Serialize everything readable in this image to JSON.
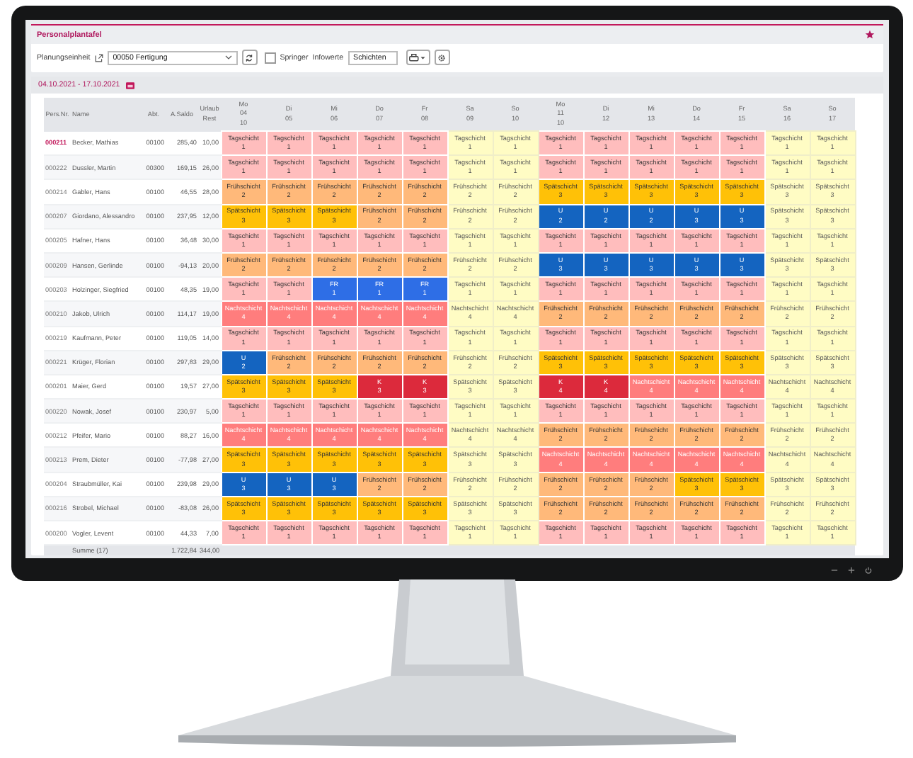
{
  "app": {
    "title": "Personalplantafel"
  },
  "toolbar": {
    "unit_label": "Planungseinheit",
    "unit_value": "00050 Fertigung",
    "springer": {
      "label": "Springer",
      "checked": false
    },
    "info_label": "Infowerte",
    "info_value": "Schichten"
  },
  "period": {
    "label": "04.10.2021 - 17.10.2021"
  },
  "table": {
    "columns": [
      "Pers.Nr.",
      "Name",
      "Abt.",
      "A.Saldo",
      "Urlaub Rest"
    ],
    "days": [
      {
        "weekday": "Mo",
        "date": "04",
        "week": "10",
        "weekend": false
      },
      {
        "weekday": "Di",
        "date": "05",
        "weekend": false
      },
      {
        "weekday": "Mi",
        "date": "06",
        "weekend": false
      },
      {
        "weekday": "Do",
        "date": "07",
        "weekend": false
      },
      {
        "weekday": "Fr",
        "date": "08",
        "weekend": false
      },
      {
        "weekday": "Sa",
        "date": "09",
        "weekend": true
      },
      {
        "weekday": "So",
        "date": "10",
        "weekend": true
      },
      {
        "weekday": "Mo",
        "date": "11",
        "week": "10",
        "weekend": false
      },
      {
        "weekday": "Di",
        "date": "12",
        "weekend": false
      },
      {
        "weekday": "Mi",
        "date": "13",
        "weekend": false
      },
      {
        "weekday": "Do",
        "date": "14",
        "weekend": false
      },
      {
        "weekday": "Fr",
        "date": "15",
        "weekend": false
      },
      {
        "weekday": "Sa",
        "date": "16",
        "weekend": true
      },
      {
        "weekday": "So",
        "date": "17",
        "weekend": true
      }
    ],
    "rows": [
      {
        "id": "000211",
        "selected": true,
        "name": "Becker, Mathias",
        "dept": "00100",
        "saldo": "285,40",
        "vacation": "10,00",
        "cells": [
          {
            "kind": "tag",
            "label": "Tagschicht",
            "code": "1"
          },
          {
            "kind": "tag",
            "label": "Tagschicht",
            "code": "1"
          },
          {
            "kind": "tag",
            "label": "Tagschicht",
            "code": "1"
          },
          {
            "kind": "tag",
            "label": "Tagschicht",
            "code": "1"
          },
          {
            "kind": "tag",
            "label": "Tagschicht",
            "code": "1"
          },
          {
            "kind": "tag",
            "label": "Tagschicht",
            "code": "1"
          },
          {
            "kind": "tag",
            "label": "Tagschicht",
            "code": "1"
          },
          {
            "kind": "tag",
            "label": "Tagschicht",
            "code": "1"
          },
          {
            "kind": "tag",
            "label": "Tagschicht",
            "code": "1"
          },
          {
            "kind": "tag",
            "label": "Tagschicht",
            "code": "1"
          },
          {
            "kind": "tag",
            "label": "Tagschicht",
            "code": "1"
          },
          {
            "kind": "tag",
            "label": "Tagschicht",
            "code": "1"
          },
          {
            "kind": "tag",
            "label": "Tagschicht",
            "code": "1"
          },
          {
            "kind": "tag",
            "label": "Tagschicht",
            "code": "1"
          }
        ]
      },
      {
        "id": "000222",
        "selected": false,
        "name": "Dussler, Martin",
        "dept": "00300",
        "saldo": "169,15",
        "vacation": "26,00",
        "cells": [
          {
            "kind": "tag",
            "label": "Tagschicht",
            "code": "1"
          },
          {
            "kind": "tag",
            "label": "Tagschicht",
            "code": "1"
          },
          {
            "kind": "tag",
            "label": "Tagschicht",
            "code": "1"
          },
          {
            "kind": "tag",
            "label": "Tagschicht",
            "code": "1"
          },
          {
            "kind": "tag",
            "label": "Tagschicht",
            "code": "1"
          },
          {
            "kind": "tag",
            "label": "Tagschicht",
            "code": "1"
          },
          {
            "kind": "tag",
            "label": "Tagschicht",
            "code": "1"
          },
          {
            "kind": "tag",
            "label": "Tagschicht",
            "code": "1"
          },
          {
            "kind": "tag",
            "label": "Tagschicht",
            "code": "1"
          },
          {
            "kind": "tag",
            "label": "Tagschicht",
            "code": "1"
          },
          {
            "kind": "tag",
            "label": "Tagschicht",
            "code": "1"
          },
          {
            "kind": "tag",
            "label": "Tagschicht",
            "code": "1"
          },
          {
            "kind": "tag",
            "label": "Tagschicht",
            "code": "1"
          },
          {
            "kind": "tag",
            "label": "Tagschicht",
            "code": "1"
          }
        ]
      },
      {
        "id": "000214",
        "selected": false,
        "name": "Gabler, Hans",
        "dept": "00100",
        "saldo": "46,55",
        "vacation": "28,00",
        "cells": [
          {
            "kind": "frueh",
            "label": "Frühschicht",
            "code": "2"
          },
          {
            "kind": "frueh",
            "label": "Frühschicht",
            "code": "2"
          },
          {
            "kind": "frueh",
            "label": "Frühschicht",
            "code": "2"
          },
          {
            "kind": "frueh",
            "label": "Frühschicht",
            "code": "2"
          },
          {
            "kind": "frueh",
            "label": "Frühschicht",
            "code": "2"
          },
          {
            "kind": "frueh",
            "label": "Frühschicht",
            "code": "2"
          },
          {
            "kind": "frueh",
            "label": "Frühschicht",
            "code": "2"
          },
          {
            "kind": "spaet",
            "label": "Spätschicht",
            "code": "3"
          },
          {
            "kind": "spaet",
            "label": "Spätschicht",
            "code": "3"
          },
          {
            "kind": "spaet",
            "label": "Spätschicht",
            "code": "3"
          },
          {
            "kind": "spaet",
            "label": "Spätschicht",
            "code": "3"
          },
          {
            "kind": "spaet",
            "label": "Spätschicht",
            "code": "3"
          },
          {
            "kind": "spaet",
            "label": "Spätschicht",
            "code": "3"
          },
          {
            "kind": "spaet",
            "label": "Spätschicht",
            "code": "3"
          }
        ]
      },
      {
        "id": "000207",
        "selected": false,
        "name": "Giordano, Alessandro",
        "dept": "00100",
        "saldo": "237,95",
        "vacation": "12,00",
        "cells": [
          {
            "kind": "spaet",
            "label": "Spätschicht",
            "code": "3"
          },
          {
            "kind": "spaet",
            "label": "Spätschicht",
            "code": "3"
          },
          {
            "kind": "spaet",
            "label": "Spätschicht",
            "code": "3"
          },
          {
            "kind": "frueh",
            "label": "Frühschicht",
            "code": "2"
          },
          {
            "kind": "frueh",
            "label": "Frühschicht",
            "code": "2"
          },
          {
            "kind": "frueh",
            "label": "Frühschicht",
            "code": "2"
          },
          {
            "kind": "frueh",
            "label": "Frühschicht",
            "code": "2"
          },
          {
            "kind": "urlaub",
            "label": "U",
            "code": "2"
          },
          {
            "kind": "urlaub",
            "label": "U",
            "code": "2"
          },
          {
            "kind": "urlaub",
            "label": "U",
            "code": "2"
          },
          {
            "kind": "urlaub",
            "label": "U",
            "code": "3"
          },
          {
            "kind": "urlaub",
            "label": "U",
            "code": "3"
          },
          {
            "kind": "spaet",
            "label": "Spätschicht",
            "code": "3"
          },
          {
            "kind": "spaet",
            "label": "Spätschicht",
            "code": "3"
          }
        ]
      },
      {
        "id": "000205",
        "selected": false,
        "name": "Hafner, Hans",
        "dept": "00100",
        "saldo": "36,48",
        "vacation": "30,00",
        "cells": [
          {
            "kind": "tag",
            "label": "Tagschicht",
            "code": "1"
          },
          {
            "kind": "tag",
            "label": "Tagschicht",
            "code": "1"
          },
          {
            "kind": "tag",
            "label": "Tagschicht",
            "code": "1"
          },
          {
            "kind": "tag",
            "label": "Tagschicht",
            "code": "1"
          },
          {
            "kind": "tag",
            "label": "Tagschicht",
            "code": "1"
          },
          {
            "kind": "tag",
            "label": "Tagschicht",
            "code": "1"
          },
          {
            "kind": "tag",
            "label": "Tagschicht",
            "code": "1"
          },
          {
            "kind": "tag",
            "label": "Tagschicht",
            "code": "1"
          },
          {
            "kind": "tag",
            "label": "Tagschicht",
            "code": "1"
          },
          {
            "kind": "tag",
            "label": "Tagschicht",
            "code": "1"
          },
          {
            "kind": "tag",
            "label": "Tagschicht",
            "code": "1"
          },
          {
            "kind": "tag",
            "label": "Tagschicht",
            "code": "1"
          },
          {
            "kind": "tag",
            "label": "Tagschicht",
            "code": "1"
          },
          {
            "kind": "tag",
            "label": "Tagschicht",
            "code": "1"
          }
        ]
      },
      {
        "id": "000209",
        "selected": false,
        "name": "Hansen, Gerlinde",
        "dept": "00100",
        "saldo": "-94,13",
        "vacation": "20,00",
        "cells": [
          {
            "kind": "frueh",
            "label": "Frühschicht",
            "code": "2"
          },
          {
            "kind": "frueh",
            "label": "Frühschicht",
            "code": "2"
          },
          {
            "kind": "frueh",
            "label": "Frühschicht",
            "code": "2"
          },
          {
            "kind": "frueh",
            "label": "Frühschicht",
            "code": "2"
          },
          {
            "kind": "frueh",
            "label": "Frühschicht",
            "code": "2"
          },
          {
            "kind": "frueh",
            "label": "Frühschicht",
            "code": "2"
          },
          {
            "kind": "frueh",
            "label": "Frühschicht",
            "code": "2"
          },
          {
            "kind": "urlaub",
            "label": "U",
            "code": "3"
          },
          {
            "kind": "urlaub",
            "label": "U",
            "code": "3"
          },
          {
            "kind": "urlaub",
            "label": "U",
            "code": "3"
          },
          {
            "kind": "urlaub",
            "label": "U",
            "code": "3"
          },
          {
            "kind": "urlaub",
            "label": "U",
            "code": "3"
          },
          {
            "kind": "spaet",
            "label": "Spätschicht",
            "code": "3"
          },
          {
            "kind": "spaet",
            "label": "Spätschicht",
            "code": "3"
          }
        ]
      },
      {
        "id": "000203",
        "selected": false,
        "name": "Holzinger, Siegfried",
        "dept": "00100",
        "saldo": "48,35",
        "vacation": "19,00",
        "cells": [
          {
            "kind": "tag",
            "label": "Tagschicht",
            "code": "1"
          },
          {
            "kind": "tag",
            "label": "Tagschicht",
            "code": "1"
          },
          {
            "kind": "frei",
            "label": "FR",
            "code": "1"
          },
          {
            "kind": "frei",
            "label": "FR",
            "code": "1"
          },
          {
            "kind": "frei",
            "label": "FR",
            "code": "1"
          },
          {
            "kind": "tag",
            "label": "Tagschicht",
            "code": "1"
          },
          {
            "kind": "tag",
            "label": "Tagschicht",
            "code": "1"
          },
          {
            "kind": "tag",
            "label": "Tagschicht",
            "code": "1"
          },
          {
            "kind": "tag",
            "label": "Tagschicht",
            "code": "1"
          },
          {
            "kind": "tag",
            "label": "Tagschicht",
            "code": "1"
          },
          {
            "kind": "tag",
            "label": "Tagschicht",
            "code": "1"
          },
          {
            "kind": "tag",
            "label": "Tagschicht",
            "code": "1"
          },
          {
            "kind": "tag",
            "label": "Tagschicht",
            "code": "1"
          },
          {
            "kind": "tag",
            "label": "Tagschicht",
            "code": "1"
          }
        ]
      },
      {
        "id": "000210",
        "selected": false,
        "name": "Jakob, Ulrich",
        "dept": "00100",
        "saldo": "114,17",
        "vacation": "19,00",
        "cells": [
          {
            "kind": "nacht",
            "label": "Nachtschicht",
            "code": "4"
          },
          {
            "kind": "nacht",
            "label": "Nachtschicht",
            "code": "4"
          },
          {
            "kind": "nacht",
            "label": "Nachtschicht",
            "code": "4"
          },
          {
            "kind": "nacht",
            "label": "Nachtschicht",
            "code": "4"
          },
          {
            "kind": "nacht",
            "label": "Nachtschicht",
            "code": "4"
          },
          {
            "kind": "nacht",
            "label": "Nachtschicht",
            "code": "4"
          },
          {
            "kind": "nacht",
            "label": "Nachtschicht",
            "code": "4"
          },
          {
            "kind": "frueh",
            "label": "Frühschicht",
            "code": "2"
          },
          {
            "kind": "frueh",
            "label": "Frühschicht",
            "code": "2"
          },
          {
            "kind": "frueh",
            "label": "Frühschicht",
            "code": "2"
          },
          {
            "kind": "frueh",
            "label": "Frühschicht",
            "code": "2"
          },
          {
            "kind": "frueh",
            "label": "Frühschicht",
            "code": "2"
          },
          {
            "kind": "frueh",
            "label": "Frühschicht",
            "code": "2"
          },
          {
            "kind": "frueh",
            "label": "Frühschicht",
            "code": "2"
          }
        ]
      },
      {
        "id": "000219",
        "selected": false,
        "name": "Kaufmann, Peter",
        "dept": "00100",
        "saldo": "119,05",
        "vacation": "14,00",
        "cells": [
          {
            "kind": "tag",
            "label": "Tagschicht",
            "code": "1"
          },
          {
            "kind": "tag",
            "label": "Tagschicht",
            "code": "1"
          },
          {
            "kind": "tag",
            "label": "Tagschicht",
            "code": "1"
          },
          {
            "kind": "tag",
            "label": "Tagschicht",
            "code": "1"
          },
          {
            "kind": "tag",
            "label": "Tagschicht",
            "code": "1"
          },
          {
            "kind": "tag",
            "label": "Tagschicht",
            "code": "1"
          },
          {
            "kind": "tag",
            "label": "Tagschicht",
            "code": "1"
          },
          {
            "kind": "tag",
            "label": "Tagschicht",
            "code": "1"
          },
          {
            "kind": "tag",
            "label": "Tagschicht",
            "code": "1"
          },
          {
            "kind": "tag",
            "label": "Tagschicht",
            "code": "1"
          },
          {
            "kind": "tag",
            "label": "Tagschicht",
            "code": "1"
          },
          {
            "kind": "tag",
            "label": "Tagschicht",
            "code": "1"
          },
          {
            "kind": "tag",
            "label": "Tagschicht",
            "code": "1"
          },
          {
            "kind": "tag",
            "label": "Tagschicht",
            "code": "1"
          }
        ]
      },
      {
        "id": "000221",
        "selected": false,
        "name": "Krüger, Florian",
        "dept": "00100",
        "saldo": "297,83",
        "vacation": "29,00",
        "cells": [
          {
            "kind": "urlaub",
            "label": "U",
            "code": "2"
          },
          {
            "kind": "frueh",
            "label": "Frühschicht",
            "code": "2"
          },
          {
            "kind": "frueh",
            "label": "Frühschicht",
            "code": "2"
          },
          {
            "kind": "frueh",
            "label": "Frühschicht",
            "code": "2"
          },
          {
            "kind": "frueh",
            "label": "Frühschicht",
            "code": "2"
          },
          {
            "kind": "frueh",
            "label": "Frühschicht",
            "code": "2"
          },
          {
            "kind": "frueh",
            "label": "Frühschicht",
            "code": "2"
          },
          {
            "kind": "spaet",
            "label": "Spätschicht",
            "code": "3"
          },
          {
            "kind": "spaet",
            "label": "Spätschicht",
            "code": "3"
          },
          {
            "kind": "spaet",
            "label": "Spätschicht",
            "code": "3"
          },
          {
            "kind": "spaet",
            "label": "Spätschicht",
            "code": "3"
          },
          {
            "kind": "spaet",
            "label": "Spätschicht",
            "code": "3"
          },
          {
            "kind": "spaet",
            "label": "Spätschicht",
            "code": "3"
          },
          {
            "kind": "spaet",
            "label": "Spätschicht",
            "code": "3"
          }
        ]
      },
      {
        "id": "000201",
        "selected": false,
        "name": "Maier, Gerd",
        "dept": "00100",
        "saldo": "19,57",
        "vacation": "27,00",
        "cells": [
          {
            "kind": "spaet",
            "label": "Spätschicht",
            "code": "3"
          },
          {
            "kind": "spaet",
            "label": "Spätschicht",
            "code": "3"
          },
          {
            "kind": "spaet",
            "label": "Spätschicht",
            "code": "3"
          },
          {
            "kind": "krank",
            "label": "K",
            "code": "3"
          },
          {
            "kind": "krank",
            "label": "K",
            "code": "3"
          },
          {
            "kind": "spaet",
            "label": "Spätschicht",
            "code": "3"
          },
          {
            "kind": "spaet",
            "label": "Spätschicht",
            "code": "3"
          },
          {
            "kind": "krank",
            "label": "K",
            "code": "4"
          },
          {
            "kind": "krank",
            "label": "K",
            "code": "4"
          },
          {
            "kind": "nacht",
            "label": "Nachtschicht",
            "code": "4"
          },
          {
            "kind": "nacht",
            "label": "Nachtschicht",
            "code": "4"
          },
          {
            "kind": "nacht",
            "label": "Nachtschicht",
            "code": "4"
          },
          {
            "kind": "nacht",
            "label": "Nachtschicht",
            "code": "4"
          },
          {
            "kind": "nacht",
            "label": "Nachtschicht",
            "code": "4"
          }
        ]
      },
      {
        "id": "000220",
        "selected": false,
        "name": "Nowak, Josef",
        "dept": "00100",
        "saldo": "230,97",
        "vacation": "5,00",
        "cells": [
          {
            "kind": "tag",
            "label": "Tagschicht",
            "code": "1"
          },
          {
            "kind": "tag",
            "label": "Tagschicht",
            "code": "1"
          },
          {
            "kind": "tag",
            "label": "Tagschicht",
            "code": "1"
          },
          {
            "kind": "tag",
            "label": "Tagschicht",
            "code": "1"
          },
          {
            "kind": "tag",
            "label": "Tagschicht",
            "code": "1"
          },
          {
            "kind": "tag",
            "label": "Tagschicht",
            "code": "1"
          },
          {
            "kind": "tag",
            "label": "Tagschicht",
            "code": "1"
          },
          {
            "kind": "tag",
            "label": "Tagschicht",
            "code": "1"
          },
          {
            "kind": "tag",
            "label": "Tagschicht",
            "code": "1"
          },
          {
            "kind": "tag",
            "label": "Tagschicht",
            "code": "1"
          },
          {
            "kind": "tag",
            "label": "Tagschicht",
            "code": "1"
          },
          {
            "kind": "tag",
            "label": "Tagschicht",
            "code": "1"
          },
          {
            "kind": "tag",
            "label": "Tagschicht",
            "code": "1"
          },
          {
            "kind": "tag",
            "label": "Tagschicht",
            "code": "1"
          }
        ]
      },
      {
        "id": "000212",
        "selected": false,
        "name": "Pfeifer, Mario",
        "dept": "00100",
        "saldo": "88,27",
        "vacation": "16,00",
        "cells": [
          {
            "kind": "nacht",
            "label": "Nachtschicht",
            "code": "4"
          },
          {
            "kind": "nacht",
            "label": "Nachtschicht",
            "code": "4"
          },
          {
            "kind": "nacht",
            "label": "Nachtschicht",
            "code": "4"
          },
          {
            "kind": "nacht",
            "label": "Nachtschicht",
            "code": "4"
          },
          {
            "kind": "nacht",
            "label": "Nachtschicht",
            "code": "4"
          },
          {
            "kind": "nacht",
            "label": "Nachtschicht",
            "code": "4"
          },
          {
            "kind": "nacht",
            "label": "Nachtschicht",
            "code": "4"
          },
          {
            "kind": "frueh",
            "label": "Frühschicht",
            "code": "2"
          },
          {
            "kind": "frueh",
            "label": "Frühschicht",
            "code": "2"
          },
          {
            "kind": "frueh",
            "label": "Frühschicht",
            "code": "2"
          },
          {
            "kind": "frueh",
            "label": "Frühschicht",
            "code": "2"
          },
          {
            "kind": "frueh",
            "label": "Frühschicht",
            "code": "2"
          },
          {
            "kind": "frueh",
            "label": "Frühschicht",
            "code": "2"
          },
          {
            "kind": "frueh",
            "label": "Frühschicht",
            "code": "2"
          }
        ]
      },
      {
        "id": "000213",
        "selected": false,
        "name": "Prem, Dieter",
        "dept": "00100",
        "saldo": "-77,98",
        "vacation": "27,00",
        "cells": [
          {
            "kind": "spaet",
            "label": "Spätschicht",
            "code": "3"
          },
          {
            "kind": "spaet",
            "label": "Spätschicht",
            "code": "3"
          },
          {
            "kind": "spaet",
            "label": "Spätschicht",
            "code": "3"
          },
          {
            "kind": "spaet",
            "label": "Spätschicht",
            "code": "3"
          },
          {
            "kind": "spaet",
            "label": "Spätschicht",
            "code": "3"
          },
          {
            "kind": "spaet",
            "label": "Spätschicht",
            "code": "3"
          },
          {
            "kind": "spaet",
            "label": "Spätschicht",
            "code": "3"
          },
          {
            "kind": "nacht",
            "label": "Nachtschicht",
            "code": "4"
          },
          {
            "kind": "nacht",
            "label": "Nachtschicht",
            "code": "4"
          },
          {
            "kind": "nacht",
            "label": "Nachtschicht",
            "code": "4"
          },
          {
            "kind": "nacht",
            "label": "Nachtschicht",
            "code": "4"
          },
          {
            "kind": "nacht",
            "label": "Nachtschicht",
            "code": "4"
          },
          {
            "kind": "nacht",
            "label": "Nachtschicht",
            "code": "4"
          },
          {
            "kind": "nacht",
            "label": "Nachtschicht",
            "code": "4"
          }
        ]
      },
      {
        "id": "000204",
        "selected": false,
        "name": "Straubmüller, Kai",
        "dept": "00100",
        "saldo": "239,98",
        "vacation": "29,00",
        "cells": [
          {
            "kind": "urlaub",
            "label": "U",
            "code": "3"
          },
          {
            "kind": "urlaub",
            "label": "U",
            "code": "3"
          },
          {
            "kind": "urlaub",
            "label": "U",
            "code": "3"
          },
          {
            "kind": "frueh",
            "label": "Frühschicht",
            "code": "2"
          },
          {
            "kind": "frueh",
            "label": "Frühschicht",
            "code": "2"
          },
          {
            "kind": "frueh",
            "label": "Frühschicht",
            "code": "2"
          },
          {
            "kind": "frueh",
            "label": "Frühschicht",
            "code": "2"
          },
          {
            "kind": "frueh",
            "label": "Frühschicht",
            "code": "2"
          },
          {
            "kind": "frueh",
            "label": "Frühschicht",
            "code": "2"
          },
          {
            "kind": "frueh",
            "label": "Frühschicht",
            "code": "2"
          },
          {
            "kind": "spaet",
            "label": "Spätschicht",
            "code": "3"
          },
          {
            "kind": "spaet",
            "label": "Spätschicht",
            "code": "3"
          },
          {
            "kind": "spaet",
            "label": "Spätschicht",
            "code": "3"
          },
          {
            "kind": "spaet",
            "label": "Spätschicht",
            "code": "3"
          }
        ]
      },
      {
        "id": "000216",
        "selected": false,
        "name": "Strobel, Michael",
        "dept": "00100",
        "saldo": "-83,08",
        "vacation": "26,00",
        "cells": [
          {
            "kind": "spaet",
            "label": "Spätschicht",
            "code": "3"
          },
          {
            "kind": "spaet",
            "label": "Spätschicht",
            "code": "3"
          },
          {
            "kind": "spaet",
            "label": "Spätschicht",
            "code": "3"
          },
          {
            "kind": "spaet",
            "label": "Spätschicht",
            "code": "3"
          },
          {
            "kind": "spaet",
            "label": "Spätschicht",
            "code": "3"
          },
          {
            "kind": "spaet",
            "label": "Spätschicht",
            "code": "3"
          },
          {
            "kind": "spaet",
            "label": "Spätschicht",
            "code": "3"
          },
          {
            "kind": "frueh",
            "label": "Frühschicht",
            "code": "2"
          },
          {
            "kind": "frueh",
            "label": "Frühschicht",
            "code": "2"
          },
          {
            "kind": "frueh",
            "label": "Frühschicht",
            "code": "2"
          },
          {
            "kind": "frueh",
            "label": "Frühschicht",
            "code": "2"
          },
          {
            "kind": "frueh",
            "label": "Frühschicht",
            "code": "2"
          },
          {
            "kind": "frueh",
            "label": "Frühschicht",
            "code": "2"
          },
          {
            "kind": "frueh",
            "label": "Frühschicht",
            "code": "2"
          }
        ]
      },
      {
        "id": "000200",
        "selected": false,
        "name": "Vogler, Levent",
        "dept": "00100",
        "saldo": "44,33",
        "vacation": "7,00",
        "cells": [
          {
            "kind": "tag",
            "label": "Tagschicht",
            "code": "1"
          },
          {
            "kind": "tag",
            "label": "Tagschicht",
            "code": "1"
          },
          {
            "kind": "tag",
            "label": "Tagschicht",
            "code": "1"
          },
          {
            "kind": "tag",
            "label": "Tagschicht",
            "code": "1"
          },
          {
            "kind": "tag",
            "label": "Tagschicht",
            "code": "1"
          },
          {
            "kind": "tag",
            "label": "Tagschicht",
            "code": "1"
          },
          {
            "kind": "tag",
            "label": "Tagschicht",
            "code": "1"
          },
          {
            "kind": "tag",
            "label": "Tagschicht",
            "code": "1"
          },
          {
            "kind": "tag",
            "label": "Tagschicht",
            "code": "1"
          },
          {
            "kind": "tag",
            "label": "Tagschicht",
            "code": "1"
          },
          {
            "kind": "tag",
            "label": "Tagschicht",
            "code": "1"
          },
          {
            "kind": "tag",
            "label": "Tagschicht",
            "code": "1"
          },
          {
            "kind": "tag",
            "label": "Tagschicht",
            "code": "1"
          },
          {
            "kind": "tag",
            "label": "Tagschicht",
            "code": "1"
          }
        ]
      }
    ],
    "summary": {
      "label": "Summe (17)",
      "saldo": "1.722,84",
      "vacation": "344,00"
    }
  }
}
